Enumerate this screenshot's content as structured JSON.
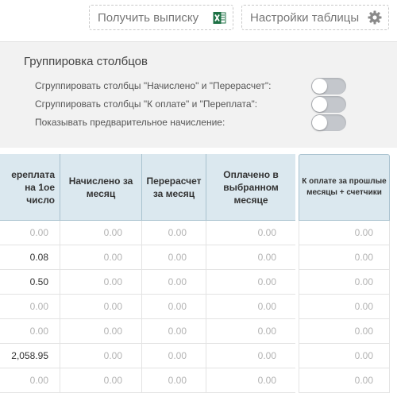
{
  "toolbar": {
    "export_label": "Получить выписку",
    "export_icon": "excel-icon",
    "settings_label": "Настройки таблицы",
    "settings_icon": "gear-icon"
  },
  "grouping": {
    "title": "Группировка столбцов",
    "options": [
      {
        "label": "Сгруппировать столбцы \"Начислено\" и \"Перерасчет\":",
        "enabled": false
      },
      {
        "label": "Сгруппировать столбцы \"К оплате\" и \"Переплата\":",
        "enabled": false
      },
      {
        "label": "Показывать предварительное начисление:",
        "enabled": false
      }
    ]
  },
  "table": {
    "headers": [
      "ереплата на 1ое число",
      "Начислено за месяц",
      "Перерасчет за месяц",
      "Оплачено в выбранном месяце",
      "К оплате за прошлые месяцы + счетчики"
    ],
    "rows": [
      [
        "0.00",
        "0.00",
        "0.00",
        "0.00",
        "0.00"
      ],
      [
        "0.08",
        "0.00",
        "0.00",
        "0.00",
        "0.00"
      ],
      [
        "0.50",
        "0.00",
        "0.00",
        "0.00",
        "0.00"
      ],
      [
        "0.00",
        "0.00",
        "0.00",
        "0.00",
        "0.00"
      ],
      [
        "0.00",
        "0.00",
        "0.00",
        "0.00",
        "0.00"
      ],
      [
        "2,058.95",
        "0.00",
        "0.00",
        "0.00",
        "0.00"
      ],
      [
        "0.00",
        "0.00",
        "0.00",
        "0.00",
        "0.00"
      ]
    ]
  },
  "colors": {
    "header_bg": "#dbe8ef",
    "panel_bg": "#f2f2f2",
    "toggle_off": "#c4c7cc",
    "muted_value": "#b3b3b3"
  }
}
